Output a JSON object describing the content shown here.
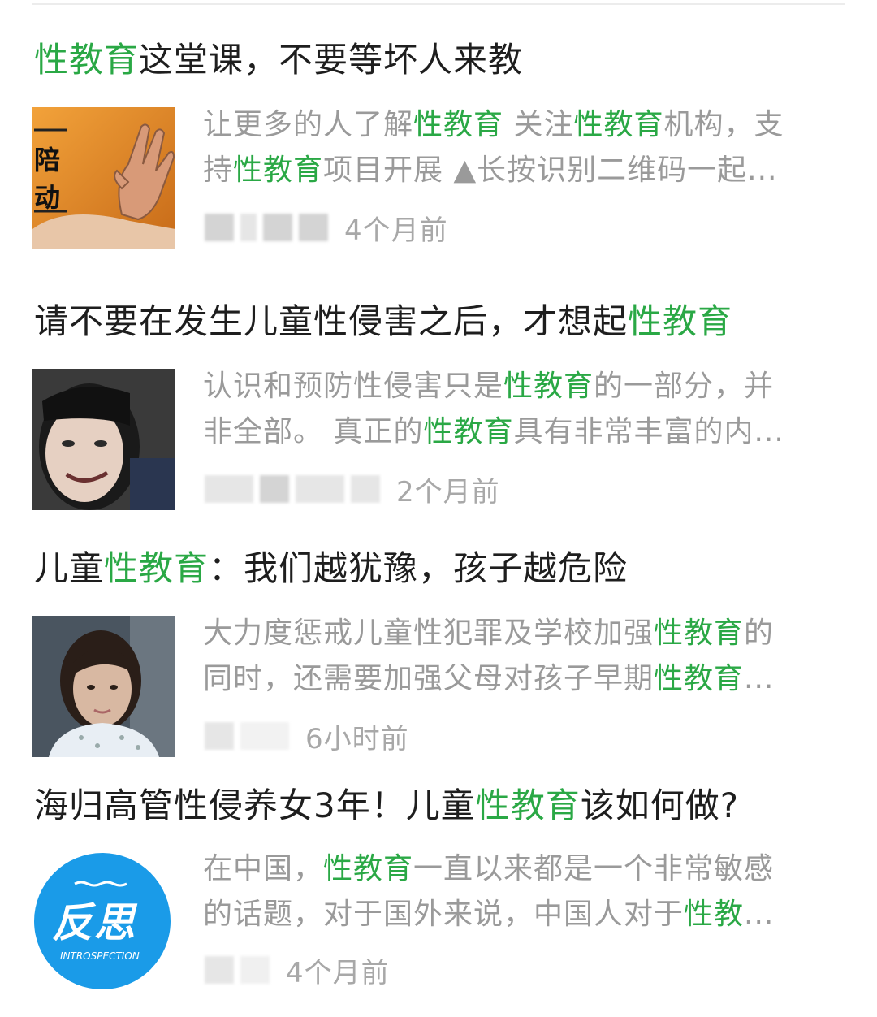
{
  "results": [
    {
      "title_parts": [
        {
          "text": "性教育",
          "hl": true
        },
        {
          "text": "这堂课，不要等坏人来教",
          "hl": false
        }
      ],
      "snippet_lines": [
        [
          {
            "text": "让更多的人了解",
            "hl": false
          },
          {
            "text": "性教育",
            "hl": true
          },
          {
            "text": " 关注",
            "hl": false
          },
          {
            "text": "性教育",
            "hl": true
          },
          {
            "text": "机构，支",
            "hl": false
          }
        ],
        [
          {
            "text": "持",
            "hl": false
          },
          {
            "text": "性教育",
            "hl": true
          },
          {
            "text": "项目开展 ▲长按识别二维码一起...",
            "hl": false
          }
        ]
      ],
      "time": "4个月前",
      "thumb_text": [
        "一",
        "陪",
        "动"
      ]
    },
    {
      "title_parts": [
        {
          "text": "请不要在发生儿童性侵害之后，才想起",
          "hl": false
        },
        {
          "text": "性教育",
          "hl": true
        }
      ],
      "snippet_lines": [
        [
          {
            "text": "认识和预防性侵害只是",
            "hl": false
          },
          {
            "text": "性教育",
            "hl": true
          },
          {
            "text": "的一部分，并",
            "hl": false
          }
        ],
        [
          {
            "text": "非全部。 真正的",
            "hl": false
          },
          {
            "text": "性教育",
            "hl": true
          },
          {
            "text": "具有非常丰富的内...",
            "hl": false
          }
        ]
      ],
      "time": "2个月前"
    },
    {
      "title_parts": [
        {
          "text": "儿童",
          "hl": false
        },
        {
          "text": "性教育",
          "hl": true
        },
        {
          "text": "：我们越犹豫，孩子越危险",
          "hl": false
        }
      ],
      "snippet_lines": [
        [
          {
            "text": "大力度惩戒儿童性犯罪及学校加强",
            "hl": false
          },
          {
            "text": "性教育",
            "hl": true
          },
          {
            "text": "的",
            "hl": false
          }
        ],
        [
          {
            "text": "同时，还需要加强父母对孩子早期",
            "hl": false
          },
          {
            "text": "性教育",
            "hl": true
          },
          {
            "text": "...",
            "hl": false
          }
        ]
      ],
      "time": "6小时前"
    },
    {
      "title_parts": [
        {
          "text": "海归高管性侵养女3年！儿童",
          "hl": false
        },
        {
          "text": "性教育",
          "hl": true
        },
        {
          "text": "该如何做?",
          "hl": false
        }
      ],
      "snippet_lines": [
        [
          {
            "text": "在中国，",
            "hl": false
          },
          {
            "text": "性教育",
            "hl": true
          },
          {
            "text": "一直以来都是一个非常敏感",
            "hl": false
          }
        ],
        [
          {
            "text": "的话题，对于国外来说，中国人对于",
            "hl": false
          },
          {
            "text": "性教",
            "hl": true
          },
          {
            "text": "...",
            "hl": false
          }
        ]
      ],
      "time": "4个月前",
      "thumb_logo": {
        "main": "反思",
        "sub": "INTROSPECTION"
      }
    }
  ],
  "colors": {
    "highlight": "#2aa845",
    "title": "#1e1e1e",
    "snippet": "#9a9a9a",
    "logo_bg": "#1a9be8"
  }
}
